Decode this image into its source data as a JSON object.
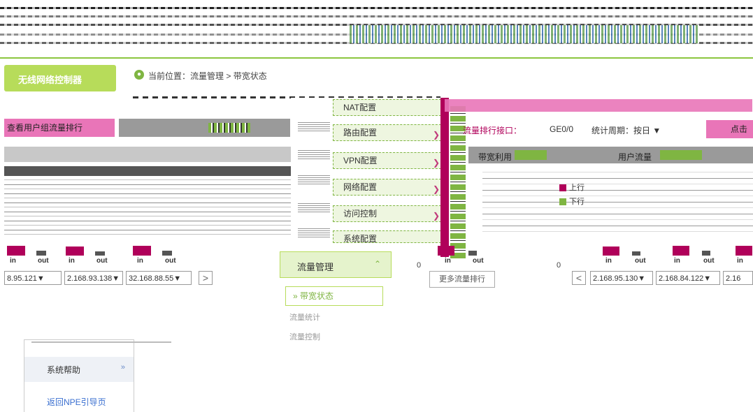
{
  "header": {
    "title_tab": "无线网络控制器"
  },
  "breadcrumb": {
    "label": "当前位置：",
    "path": "流量管理 > 带宽状态"
  },
  "left_panel": {
    "rank_button": "查看用户组流量排行",
    "chart": {
      "io_labels": [
        "in",
        "out",
        "in",
        "out",
        "in",
        "out"
      ],
      "ips": [
        "8.95.121",
        "2.168.93.138",
        "32.168.88.55"
      ],
      "next_arrow": ">"
    }
  },
  "menu": {
    "items": [
      "NAT配置",
      "路由配置",
      "VPN配置",
      "网络配置",
      "访问控制",
      "系统配置"
    ],
    "flow": {
      "label": "流量管理",
      "chevron": "⌃"
    },
    "sub_active": "带宽状态",
    "sub_items": [
      "流量统计",
      "流量控制"
    ]
  },
  "right_panel": {
    "title": "流量排行接口：",
    "iface": "GE0/0",
    "period": "统计周期：按日",
    "action_button": "点击",
    "bar_labels": [
      "带宽利用",
      "用户流量"
    ],
    "legend": [
      "上行",
      "下行"
    ],
    "axis_zero": "0",
    "io_labels": [
      "in",
      "out",
      "in",
      "out",
      "in",
      "out",
      "in"
    ],
    "prev_arrow": "<",
    "ips": [
      "2.168.95.130",
      "2.168.84.122",
      "2.16"
    ],
    "detail_button": "更多流量排行"
  },
  "left_nav": {
    "help": "系统帮助",
    "help_chevron": "»",
    "back": "返回NPE引导页"
  },
  "colors": {
    "accent_green": "#8cc63f",
    "accent_pink": "#e975b8",
    "bar_magenta": "#b0005a"
  },
  "chart_data": {
    "type": "bar",
    "categories": [
      "in",
      "out",
      "in",
      "out",
      "in",
      "out"
    ],
    "series": [
      {
        "values": [
          12,
          6,
          11,
          5,
          12,
          6
        ]
      }
    ]
  }
}
